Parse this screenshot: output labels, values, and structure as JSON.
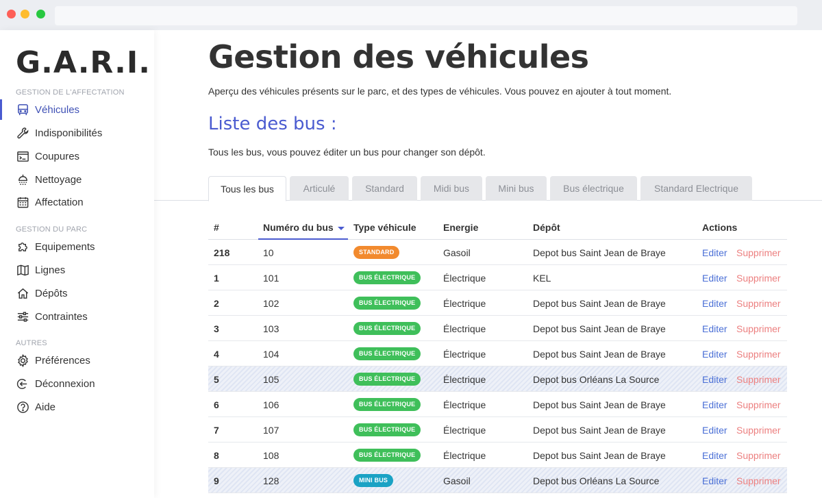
{
  "app": {
    "brand": "G.A.R.I."
  },
  "sidebar": {
    "sections": [
      {
        "title": "GESTION DE L'AFFECTATION"
      },
      {
        "title": "GESTION DU PARC"
      },
      {
        "title": "AUTRES"
      }
    ],
    "items": [
      {
        "label": "Véhicules",
        "icon": "bus-icon"
      },
      {
        "label": "Indisponibilités",
        "icon": "wrench-icon"
      },
      {
        "label": "Coupures",
        "icon": "terminal-icon"
      },
      {
        "label": "Nettoyage",
        "icon": "shower-icon"
      },
      {
        "label": "Affectation",
        "icon": "calendar-icon"
      },
      {
        "label": "Equipements",
        "icon": "puzzle-icon"
      },
      {
        "label": "Lignes",
        "icon": "map-icon"
      },
      {
        "label": "Dépôts",
        "icon": "home-icon"
      },
      {
        "label": "Contraintes",
        "icon": "sliders-icon"
      },
      {
        "label": "Préférences",
        "icon": "gear-icon"
      },
      {
        "label": "Déconnexion",
        "icon": "logout-icon"
      },
      {
        "label": "Aide",
        "icon": "help-icon"
      }
    ]
  },
  "page": {
    "title": "Gestion des véhicules",
    "lead": "Aperçu des véhicules présents sur le parc, et des types de véhicules. Vous pouvez en ajouter à tout moment.",
    "subtitle": "Liste des bus :",
    "subtext": "Tous les bus, vous pouvez éditer un bus pour changer son dépôt."
  },
  "tabs": [
    {
      "label": "Tous les bus"
    },
    {
      "label": "Articulé"
    },
    {
      "label": "Standard"
    },
    {
      "label": "Midi bus"
    },
    {
      "label": "Mini bus"
    },
    {
      "label": "Bus électrique"
    },
    {
      "label": "Standard Electrique"
    }
  ],
  "table": {
    "headers": {
      "id": "#",
      "num": "Numéro du bus",
      "type": "Type véhicule",
      "energy": "Energie",
      "depot": "Dépôt",
      "actions": "Actions"
    },
    "edit_label": "Editer",
    "delete_label": "Supprimer",
    "badge_colors": {
      "STANDARD": "#f28a2e",
      "BUS ÉLECTRIQUE": "#3fbf5a",
      "MINI BUS": "#1aa2c4"
    },
    "rows": [
      {
        "id": "218",
        "num": "10",
        "type": "STANDARD",
        "energy": "Gasoil",
        "depot": "Depot bus Saint Jean de Braye",
        "striped": false
      },
      {
        "id": "1",
        "num": "101",
        "type": "BUS ÉLECTRIQUE",
        "energy": "Électrique",
        "depot": "KEL",
        "striped": false
      },
      {
        "id": "2",
        "num": "102",
        "type": "BUS ÉLECTRIQUE",
        "energy": "Électrique",
        "depot": "Depot bus Saint Jean de Braye",
        "striped": false
      },
      {
        "id": "3",
        "num": "103",
        "type": "BUS ÉLECTRIQUE",
        "energy": "Électrique",
        "depot": "Depot bus Saint Jean de Braye",
        "striped": false
      },
      {
        "id": "4",
        "num": "104",
        "type": "BUS ÉLECTRIQUE",
        "energy": "Électrique",
        "depot": "Depot bus Saint Jean de Braye",
        "striped": false
      },
      {
        "id": "5",
        "num": "105",
        "type": "BUS ÉLECTRIQUE",
        "energy": "Électrique",
        "depot": "Depot bus Orléans La Source",
        "striped": true
      },
      {
        "id": "6",
        "num": "106",
        "type": "BUS ÉLECTRIQUE",
        "energy": "Électrique",
        "depot": "Depot bus Saint Jean de Braye",
        "striped": false
      },
      {
        "id": "7",
        "num": "107",
        "type": "BUS ÉLECTRIQUE",
        "energy": "Électrique",
        "depot": "Depot bus Saint Jean de Braye",
        "striped": false
      },
      {
        "id": "8",
        "num": "108",
        "type": "BUS ÉLECTRIQUE",
        "energy": "Électrique",
        "depot": "Depot bus Saint Jean de Braye",
        "striped": false
      },
      {
        "id": "9",
        "num": "128",
        "type": "MINI BUS",
        "energy": "Gasoil",
        "depot": "Depot bus Orléans La Source",
        "striped": true
      }
    ]
  }
}
